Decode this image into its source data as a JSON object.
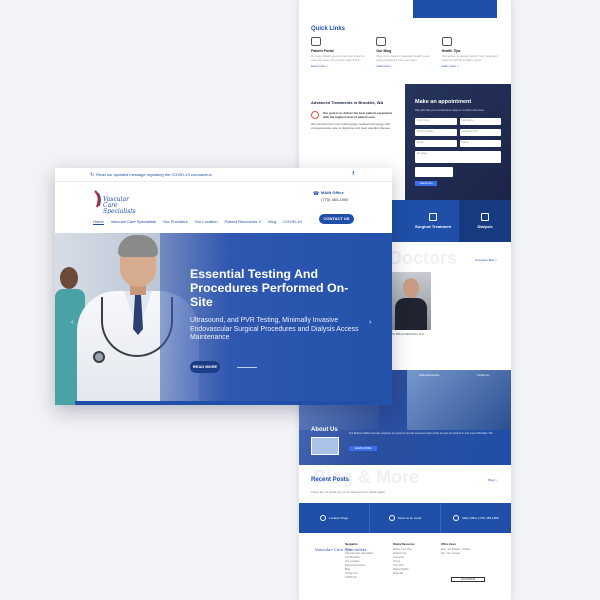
{
  "back": {
    "quick_links": {
      "title": "Quick Links",
      "items": [
        {
          "title": "Patient Portal",
          "desc": "As Lake Washington's one-stop shop for vascular care, we put the patient first.",
          "more": "learn more >"
        },
        {
          "title": "Our Blog",
          "desc": "Stay up to date on vascular health news and procedures from our team.",
          "more": "read more >"
        },
        {
          "title": "Health Tips",
          "desc": "Prevention is always better than treatment, read our tips for healthy veins.",
          "more": "learn more >"
        }
      ]
    },
    "advanced": {
      "title": "Advanced Treatments in Brooklet, WA",
      "goal": "Our goal is to deliver the best patient experience with the highest level of patient care.",
      "body": "We combine the most cutting-edge medical technology with compassionate care to diagnose and treat vascular disease."
    },
    "appointment": {
      "title": "Make an appointment",
      "sub": "We will call you in business days to confirm the time.",
      "fields": [
        "First Name",
        "Last Name",
        "Preferred Date",
        "Preferred Time",
        "Email",
        "Phone",
        "Message"
      ],
      "submit": "submit form"
    },
    "services": [
      {
        "label": "Surgical Treatment",
        "icon": "scalpel-icon"
      },
      {
        "label": "Dialysis",
        "icon": "monitor-icon"
      }
    ],
    "doctors": {
      "ghost": "Doctors",
      "more": "Complete Bios >",
      "name": "DR. BRIAN KIESSLING, M.D."
    },
    "about": {
      "tag1": "Patient Resources",
      "tag2": "Contact Us",
      "title": "About Us",
      "body": "Our Board-certified vascular surgeons are proud to provide advanced state-of-the-art care for patients in and around Brooklet, WA.",
      "button": "LEARN MORE"
    },
    "recent": {
      "ghost": "Blog & More",
      "title": "Recent Posts",
      "sub": "There are no posts yet, come back soon to check again.",
      "blog": "Blog >"
    },
    "cta": [
      {
        "text": "Location Page"
      },
      {
        "text": "Send us an email"
      },
      {
        "text": "Main Office (770) 483-1900"
      }
    ],
    "footer": {
      "navigation": {
        "title": "Navigation",
        "items": [
          "Home",
          "Vascular Care Specialists",
          "Our Providers",
          "Our Location",
          "Patient Resources",
          "Blog",
          "Contact Us",
          "COVID-19"
        ]
      },
      "resources": {
        "title": "Patient Resources",
        "items": [
          "Before Your Visit",
          "Dialysis Info",
          "Insurance",
          "Forms",
          "Your Visit",
          "Patient Rights",
          "Referrals"
        ]
      },
      "hours": {
        "title": "Office Hours",
        "lines": [
          "Mon - Fri 8:00am - 5:00pm",
          "Sat - Sun Closed"
        ]
      },
      "button": "LOCATIONS"
    }
  },
  "front": {
    "alert": {
      "text": "Read our updated message regarding the COVID-19 coronavirus",
      "icon": "refresh-icon"
    },
    "logo_text": "Vascular Care Specialists",
    "phone": {
      "label": "MAIN Office",
      "number": "(770) 483-1900"
    },
    "nav": [
      "Home",
      "Vascular Care Specialists",
      "Our Providers",
      "Our Location",
      "Patient Resources ∨",
      "Blog",
      "COVID-19"
    ],
    "contact_button": "CONTACT US",
    "hero": {
      "title": "Essential Testing And Procedures Performed On-Site",
      "subtitle": "Ultrasound, and PVR Testing, Minimally Invasive Endovascular Surgical Procedures and Dialysis Access Maintenance",
      "button": "READ MORE",
      "prev": "‹",
      "next": "›"
    }
  },
  "colors": {
    "brand_blue": "#1f4fa8",
    "dark_blue": "#173b80",
    "accent": "#e05a3a"
  }
}
